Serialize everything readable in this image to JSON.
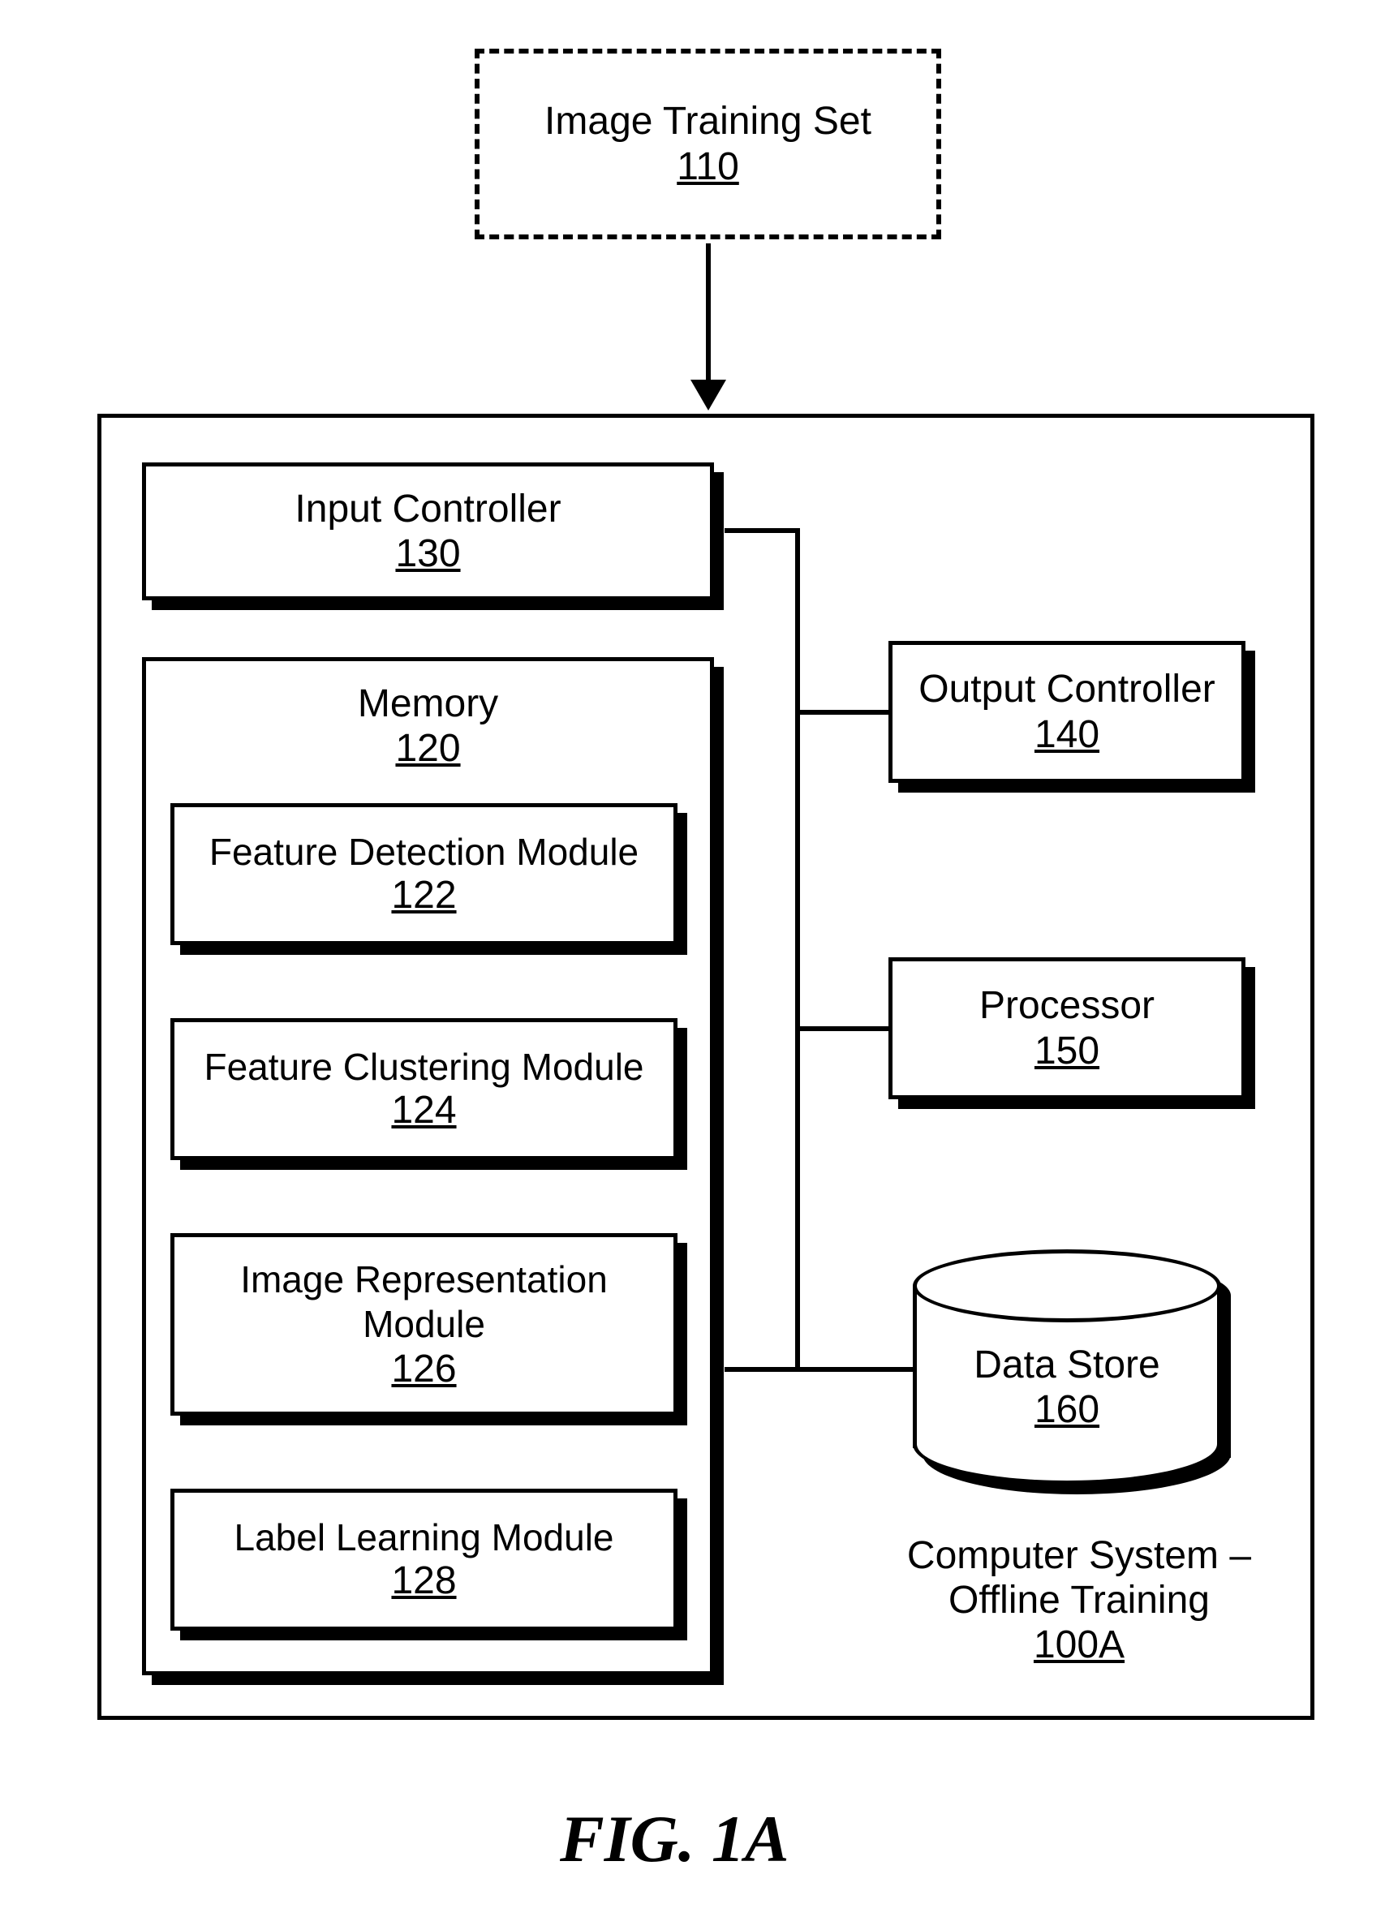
{
  "training_set": {
    "label": "Image Training Set",
    "num": "110"
  },
  "system_box": {
    "label_line1": "Computer System –",
    "label_line2": "Offline Training",
    "num": "100A"
  },
  "input_ctrl": {
    "label": "Input Controller",
    "num": "130"
  },
  "memory": {
    "label": "Memory",
    "num": "120"
  },
  "feat_detect": {
    "label": "Feature Detection Module",
    "num": "122"
  },
  "feat_cluster": {
    "label": "Feature Clustering Module",
    "num": "124"
  },
  "img_repr": {
    "label_line1": "Image Representation",
    "label_line2": "Module",
    "num": "126"
  },
  "label_learn": {
    "label": "Label Learning Module",
    "num": "128"
  },
  "output_ctrl": {
    "label": "Output Controller",
    "num": "140"
  },
  "processor": {
    "label": "Processor",
    "num": "150"
  },
  "data_store": {
    "label": "Data Store",
    "num": "160"
  },
  "figure": {
    "label": "FIG. 1A"
  }
}
